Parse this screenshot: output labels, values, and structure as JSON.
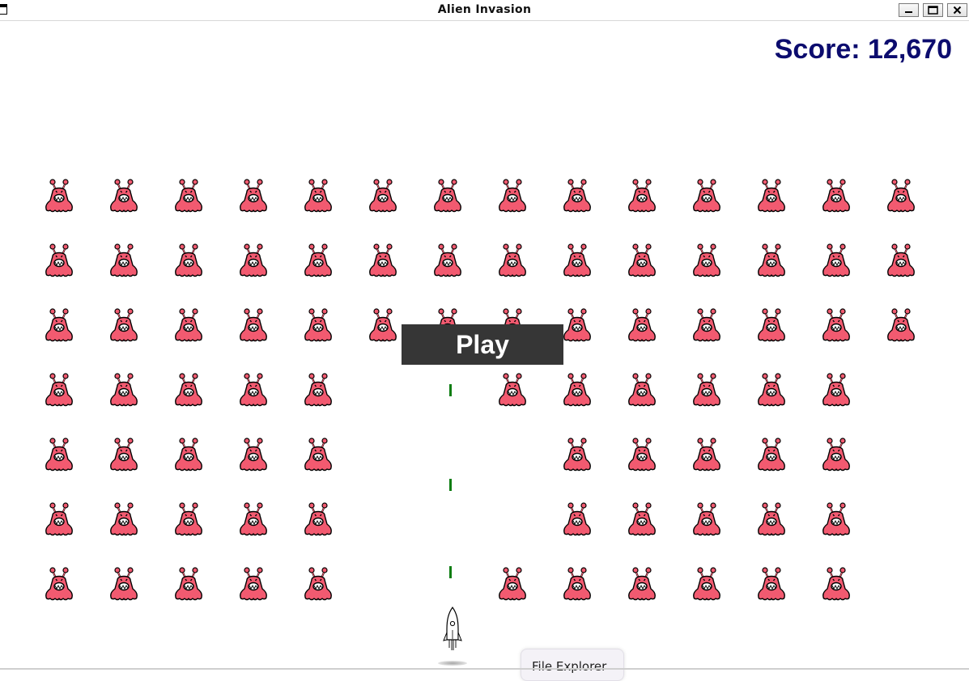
{
  "window": {
    "title": "Alien Invasion",
    "controls": [
      "minimize-icon",
      "maximize-icon",
      "close-icon"
    ]
  },
  "hud": {
    "score_text": "Score: 12,670",
    "score_color": "#0c0c6e"
  },
  "play_button": {
    "label": "Play",
    "background": "#363636"
  },
  "fleet": {
    "alien_color": "#f25a70",
    "rows": 7,
    "columns": 14,
    "present": [
      [
        1,
        1,
        1,
        1,
        1,
        1,
        1,
        1,
        1,
        1,
        1,
        1,
        1,
        1
      ],
      [
        1,
        1,
        1,
        1,
        1,
        1,
        1,
        1,
        1,
        1,
        1,
        1,
        1,
        1
      ],
      [
        1,
        1,
        1,
        1,
        1,
        1,
        1,
        1,
        1,
        1,
        1,
        1,
        1,
        1
      ],
      [
        1,
        1,
        1,
        1,
        1,
        0,
        0,
        1,
        1,
        1,
        1,
        1,
        1,
        0
      ],
      [
        1,
        1,
        1,
        1,
        1,
        0,
        0,
        0,
        1,
        1,
        1,
        1,
        1,
        0
      ],
      [
        1,
        1,
        1,
        1,
        1,
        0,
        0,
        0,
        1,
        1,
        1,
        1,
        1,
        0
      ],
      [
        1,
        1,
        1,
        1,
        1,
        0,
        0,
        1,
        1,
        1,
        1,
        1,
        1,
        0
      ]
    ]
  },
  "bullets": {
    "color": "#0d7d12",
    "count": 3
  },
  "taskbar_tooltip": {
    "label": "File Explorer"
  }
}
